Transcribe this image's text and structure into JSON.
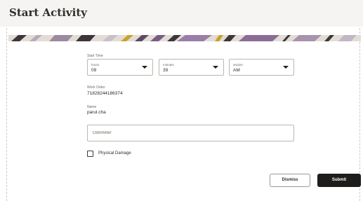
{
  "dialog": {
    "title": "Start Activity"
  },
  "start_time": {
    "label": "Start Time",
    "hours": {
      "label": "hours",
      "value": "09"
    },
    "minutes": {
      "label": "minutes",
      "value": "39"
    },
    "ampm": {
      "label": "am/pm",
      "value": "AM"
    }
  },
  "work_order": {
    "label": "Work Order",
    "value": "71828244186374"
  },
  "name": {
    "label": "Name",
    "value": "parul.cha"
  },
  "odometer": {
    "placeholder": "Odometer",
    "value": ""
  },
  "physical_damage": {
    "label": "Physical Damage",
    "checked": false
  },
  "actions": {
    "dismiss_label": "Dismiss",
    "submit_label": "Submit"
  },
  "colors": {
    "accent": "#1f1d1c",
    "banner_purple": "#7c5a87",
    "banner_gold": "#c9a227",
    "banner_dark": "#3d3538"
  }
}
